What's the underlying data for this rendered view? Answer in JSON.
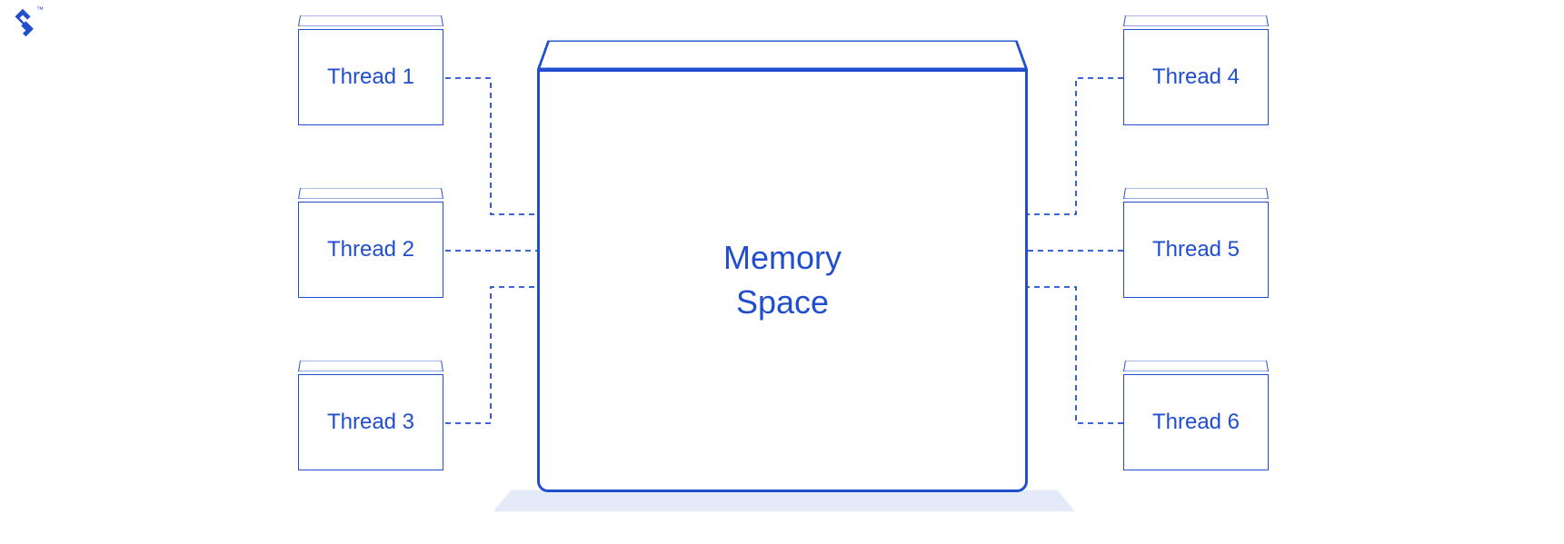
{
  "logo": {
    "label": "Toptal logo",
    "trademark": "™"
  },
  "memory": {
    "line1": "Memory",
    "line2": "Space"
  },
  "threads": {
    "left": [
      {
        "label": "Thread 1"
      },
      {
        "label": "Thread 2"
      },
      {
        "label": "Thread 3"
      }
    ],
    "right": [
      {
        "label": "Thread 4"
      },
      {
        "label": "Thread 5"
      },
      {
        "label": "Thread 6"
      }
    ]
  },
  "colors": {
    "primary": "#204ecf",
    "shadow": "#e5eaf8"
  }
}
